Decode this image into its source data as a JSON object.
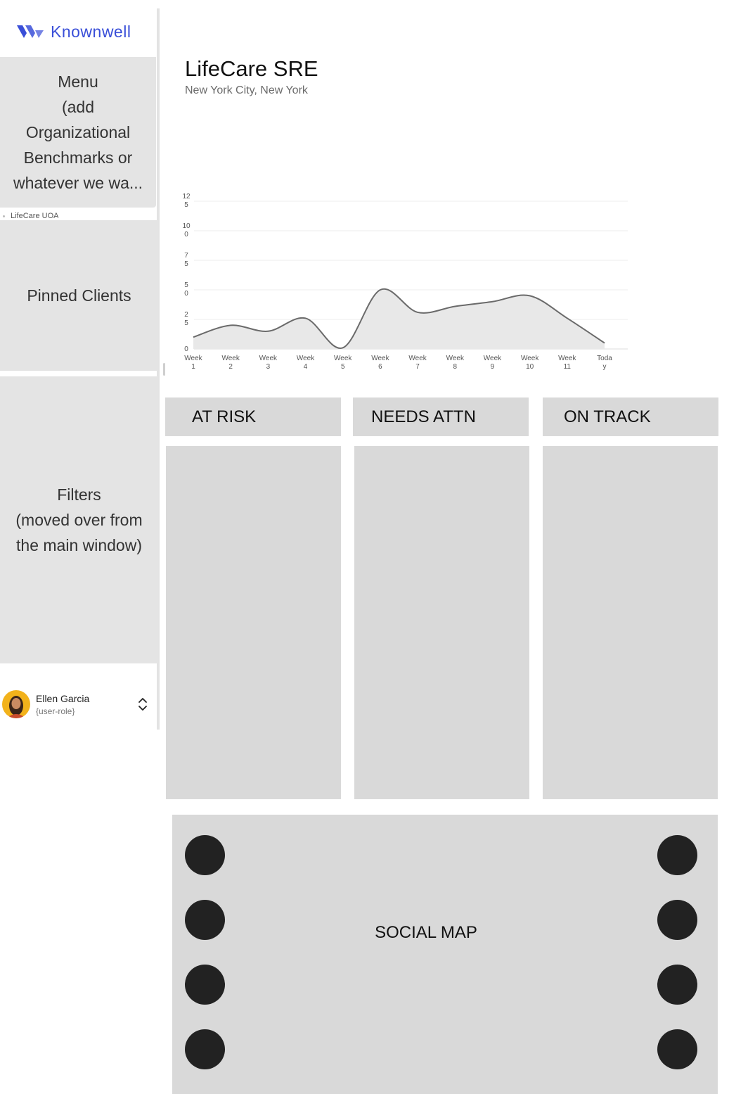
{
  "brand": {
    "name": "Knownwell",
    "color": "#3a4fd8"
  },
  "sidebar": {
    "menu_lines": [
      "Menu",
      "(add",
      "Organizational",
      "Benchmarks or",
      "whatever we wa..."
    ],
    "hidden_item": "LifeCare UOA",
    "pinned_label": "Pinned Clients",
    "filters_lines": [
      "Filters",
      "(moved over from",
      "the main window)"
    ]
  },
  "user": {
    "name": "Ellen Garcia",
    "role": "{user-role}",
    "toggle_icon": "chevron-up-down-icon"
  },
  "header": {
    "title": "LifeCare SRE",
    "subtitle": "New York City, New York"
  },
  "chart_data": {
    "type": "area",
    "title": "",
    "xlabel": "",
    "ylabel": "",
    "ylim": [
      0,
      125
    ],
    "yticks": [
      [
        "0"
      ],
      [
        "2",
        "5"
      ],
      [
        "5",
        "0"
      ],
      [
        "7",
        "5"
      ],
      [
        "10",
        "0"
      ],
      [
        "12",
        "5"
      ]
    ],
    "categories": [
      [
        "Week",
        "1"
      ],
      [
        "Week",
        "2"
      ],
      [
        "Week",
        "3"
      ],
      [
        "Week",
        "4"
      ],
      [
        "Week",
        "5"
      ],
      [
        "Week",
        "6"
      ],
      [
        "Week",
        "7"
      ],
      [
        "Week",
        "8"
      ],
      [
        "Week",
        "9"
      ],
      [
        "Week",
        "10"
      ],
      [
        "Week",
        "11"
      ],
      [
        "Toda",
        "y"
      ]
    ],
    "series": [
      {
        "values": [
          10,
          20,
          15,
          26,
          1,
          50,
          31,
          36,
          40,
          45,
          26,
          5
        ]
      }
    ],
    "grid": true,
    "line_color": "#6a6a6a",
    "fill_color": "#e8e8e8"
  },
  "columns": [
    {
      "id": "risk",
      "label": "AT RISK"
    },
    {
      "id": "attn",
      "label": "NEEDS ATTN"
    },
    {
      "id": "track",
      "label": "ON TRACK"
    }
  ],
  "social_map": {
    "label": "SOCIAL MAP"
  }
}
